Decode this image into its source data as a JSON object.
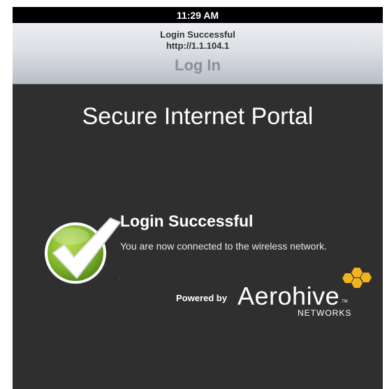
{
  "status_bar": {
    "time": "11:29 AM"
  },
  "title_bar": {
    "line1": "Login Successful",
    "line2": "http://1.1.104.1",
    "main": "Log In"
  },
  "portal": {
    "heading": "Secure Internet Portal",
    "success_title": "Login Successful",
    "success_message": "You are now connected to the wireless network.",
    "marker": "."
  },
  "branding": {
    "powered_by": "Powered by",
    "name": "Aerohive",
    "tm": "TM",
    "sub": "NETWORKS",
    "accent_color": "#f2b41c"
  },
  "icons": {
    "success": "checkmark-icon",
    "logo": "hexagon-cluster-icon"
  },
  "colors": {
    "background": "#2f2f2f",
    "checkmark_green": "#7eb52a"
  }
}
